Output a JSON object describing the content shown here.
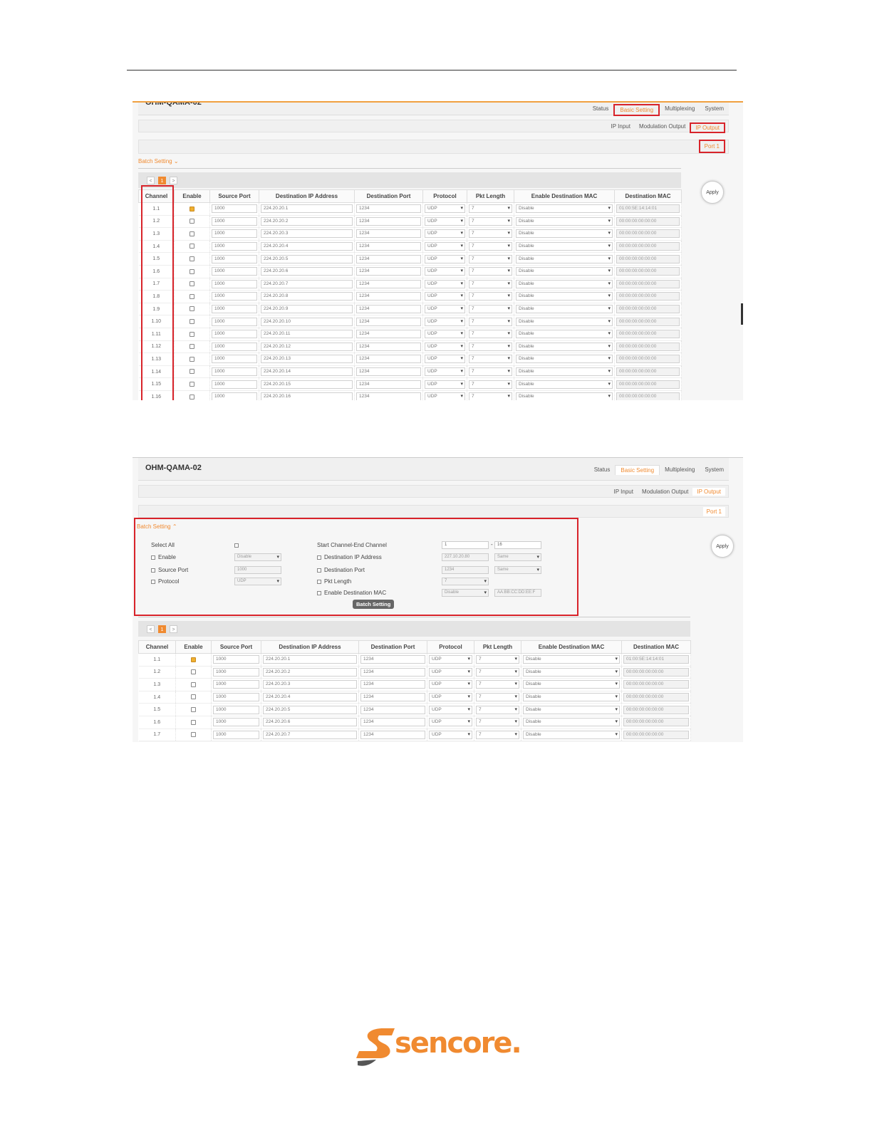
{
  "app": {
    "title": "OHM-QAMA-02"
  },
  "tabs": [
    "Status",
    "Basic Setting",
    "Multiplexing",
    "System"
  ],
  "subtabs": [
    "IP Input",
    "Modulation Output",
    "IP Output"
  ],
  "port": "Port 1",
  "batch": {
    "link_label": "Batch Setting",
    "select_all": "Select All",
    "enable": "Enable",
    "source_port": "Source Port",
    "protocol": "Protocol",
    "start_end": "Start Channel-End Channel",
    "dest_ip": "Destination IP Address",
    "dest_port": "Destination Port",
    "pkt_length": "Pkt Length",
    "enable_dest_mac": "Enable Destination MAC",
    "values": {
      "enable": "Disable",
      "source_port": "1000",
      "protocol": "UDP",
      "start": "1",
      "end": "16",
      "dest_ip": "227.10.20.80",
      "dest_ip_mode": "Same",
      "dest_port": "1234",
      "dest_port_mode": "Same",
      "pkt_length": "7",
      "enable_mac": "Disable",
      "mac": "AA:BB:CC:DD:EE:F"
    },
    "button": "Batch Setting"
  },
  "pager": {
    "prev": "<",
    "current": "1",
    "next": ">"
  },
  "apply_label": "Apply",
  "columns": [
    "Channel",
    "Enable",
    "Source Port",
    "Destination IP Address",
    "Destination Port",
    "Protocol",
    "Pkt Length",
    "Enable Destination MAC",
    "Destination MAC"
  ],
  "rows": [
    {
      "ch": "1.1",
      "src": "1000",
      "ip": "224.20.20.1",
      "dport": "1234",
      "proto": "UDP",
      "pkt": "7",
      "en_mac": "Disable",
      "mac": "01:00:5E:14:14:01",
      "enabled": true
    },
    {
      "ch": "1.2",
      "src": "1000",
      "ip": "224.20.20.2",
      "dport": "1234",
      "proto": "UDP",
      "pkt": "7",
      "en_mac": "Disable",
      "mac": "00:00:00:00:00:00",
      "enabled": false
    },
    {
      "ch": "1.3",
      "src": "1000",
      "ip": "224.20.20.3",
      "dport": "1234",
      "proto": "UDP",
      "pkt": "7",
      "en_mac": "Disable",
      "mac": "00:00:00:00:00:00",
      "enabled": false
    },
    {
      "ch": "1.4",
      "src": "1000",
      "ip": "224.20.20.4",
      "dport": "1234",
      "proto": "UDP",
      "pkt": "7",
      "en_mac": "Disable",
      "mac": "00:00:00:00:00:00",
      "enabled": false
    },
    {
      "ch": "1.5",
      "src": "1000",
      "ip": "224.20.20.5",
      "dport": "1234",
      "proto": "UDP",
      "pkt": "7",
      "en_mac": "Disable",
      "mac": "00:00:00:00:00:00",
      "enabled": false
    },
    {
      "ch": "1.6",
      "src": "1000",
      "ip": "224.20.20.6",
      "dport": "1234",
      "proto": "UDP",
      "pkt": "7",
      "en_mac": "Disable",
      "mac": "00:00:00:00:00:00",
      "enabled": false
    },
    {
      "ch": "1.7",
      "src": "1000",
      "ip": "224.20.20.7",
      "dport": "1234",
      "proto": "UDP",
      "pkt": "7",
      "en_mac": "Disable",
      "mac": "00:00:00:00:00:00",
      "enabled": false
    },
    {
      "ch": "1.8",
      "src": "1000",
      "ip": "224.20.20.8",
      "dport": "1234",
      "proto": "UDP",
      "pkt": "7",
      "en_mac": "Disable",
      "mac": "00:00:00:00:00:00",
      "enabled": false
    },
    {
      "ch": "1.9",
      "src": "1000",
      "ip": "224.20.20.9",
      "dport": "1234",
      "proto": "UDP",
      "pkt": "7",
      "en_mac": "Disable",
      "mac": "00:00:00:00:00:00",
      "enabled": false
    },
    {
      "ch": "1.10",
      "src": "1000",
      "ip": "224.20.20.10",
      "dport": "1234",
      "proto": "UDP",
      "pkt": "7",
      "en_mac": "Disable",
      "mac": "00:00:00:00:00:00",
      "enabled": false
    },
    {
      "ch": "1.11",
      "src": "1000",
      "ip": "224.20.20.11",
      "dport": "1234",
      "proto": "UDP",
      "pkt": "7",
      "en_mac": "Disable",
      "mac": "00:00:00:00:00:00",
      "enabled": false
    },
    {
      "ch": "1.12",
      "src": "1000",
      "ip": "224.20.20.12",
      "dport": "1234",
      "proto": "UDP",
      "pkt": "7",
      "en_mac": "Disable",
      "mac": "00:00:00:00:00:00",
      "enabled": false
    },
    {
      "ch": "1.13",
      "src": "1000",
      "ip": "224.20.20.13",
      "dport": "1234",
      "proto": "UDP",
      "pkt": "7",
      "en_mac": "Disable",
      "mac": "00:00:00:00:00:00",
      "enabled": false
    },
    {
      "ch": "1.14",
      "src": "1000",
      "ip": "224.20.20.14",
      "dport": "1234",
      "proto": "UDP",
      "pkt": "7",
      "en_mac": "Disable",
      "mac": "00:00:00:00:00:00",
      "enabled": false
    },
    {
      "ch": "1.15",
      "src": "1000",
      "ip": "224.20.20.15",
      "dport": "1234",
      "proto": "UDP",
      "pkt": "7",
      "en_mac": "Disable",
      "mac": "00:00:00:00:00:00",
      "enabled": false
    },
    {
      "ch": "1.16",
      "src": "1000",
      "ip": "224.20.20.16",
      "dport": "1234",
      "proto": "UDP",
      "pkt": "7",
      "en_mac": "Disable",
      "mac": "00:00:00:00:00:00",
      "enabled": false
    }
  ],
  "logo": {
    "text": "sencore.",
    "color": "#f08a30"
  },
  "colors": {
    "accent": "#f08a30",
    "highlight": "#d8232a"
  }
}
